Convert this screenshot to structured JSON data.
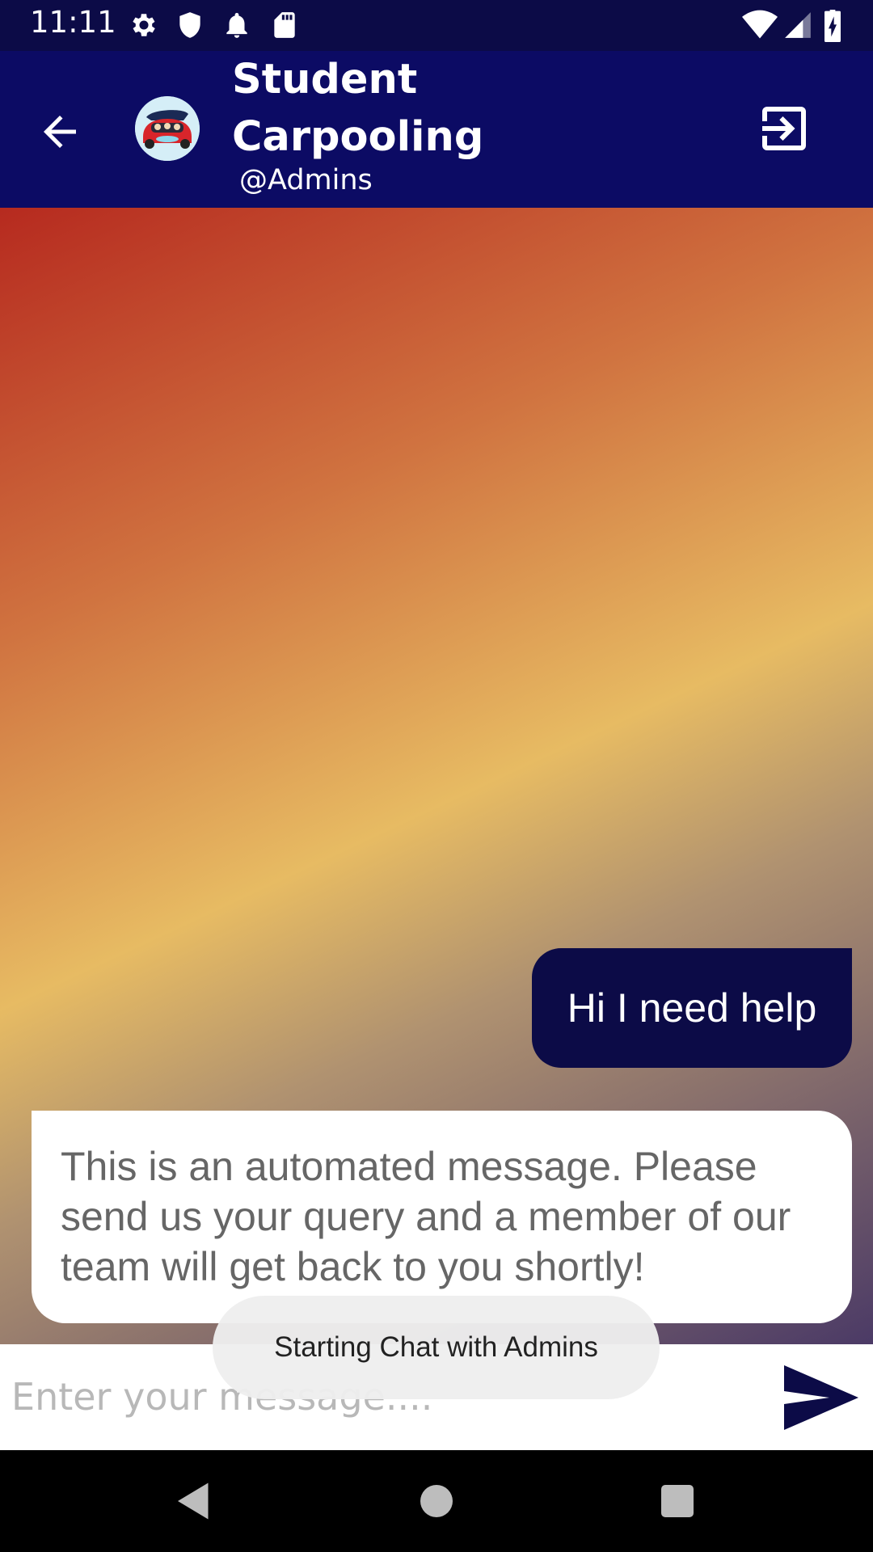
{
  "status_bar": {
    "time": "11:11",
    "left_icons": [
      "settings-icon",
      "shield-icon",
      "notification-bell-icon",
      "sd-card-icon"
    ],
    "right_icons": [
      "wifi-icon",
      "cellular-signal-icon",
      "battery-charging-icon"
    ]
  },
  "header": {
    "back_icon": "arrow-left-icon",
    "avatar": "carpool-logo",
    "title": "Student Carpooling",
    "subtitle": "@Admins",
    "exit_icon": "exit-icon"
  },
  "messages": [
    {
      "direction": "sent",
      "text": "Hi I need help"
    },
    {
      "direction": "received",
      "text": "This is an automated message. Please send us your query and a member of our team will get back to you shortly!"
    }
  ],
  "composer": {
    "placeholder": "Enter your message....",
    "value": "",
    "send_icon": "send-icon"
  },
  "toast": {
    "text": "Starting Chat with Admins"
  },
  "nav_bar": {
    "icons": [
      "back-triangle-icon",
      "home-circle-icon",
      "recents-square-icon"
    ]
  },
  "colors": {
    "status_bar": "#0c0b47",
    "app_bar": "#0c0b64",
    "sent_bubble": "#0c0b47",
    "received_bubble": "#ffffff",
    "gradient_start": "#b62a1f",
    "gradient_mid": "#e7bb63",
    "gradient_end": "#4b3a66"
  }
}
